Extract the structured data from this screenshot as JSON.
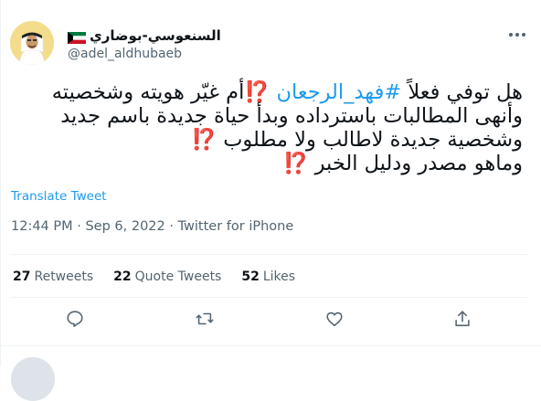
{
  "author": {
    "display_name": "السنعوسي-بوضاري",
    "handle": "@adel_aldhubaeb",
    "flag_icon": "kuwait-flag-icon"
  },
  "tweet": {
    "line1_a": "هل توفي فعلاً ",
    "hashtag": "#فهد_الرجعان",
    "line1_b": " ⁉️أم غيّر هويته وشخصيته",
    "line2": "وأنهى المطالبات باسترداده وبدأ حياة جديدة باسم جديد",
    "line3": "وشخصية جديدة لاطالب ولا مطلوب ⁉️",
    "line4": "وماهو مصدر ودليل الخبر ⁉️"
  },
  "translate_label": "Translate Tweet",
  "meta": "12:44 PM · Sep 6, 2022 · Twitter for iPhone",
  "stats": {
    "retweets_count": "27",
    "retweets_label": "Retweets",
    "quotes_count": "22",
    "quotes_label": "Quote Tweets",
    "likes_count": "52",
    "likes_label": "Likes"
  },
  "colors": {
    "accent": "#1d9bf0",
    "muted": "#536471",
    "divider": "#eff3f4"
  }
}
